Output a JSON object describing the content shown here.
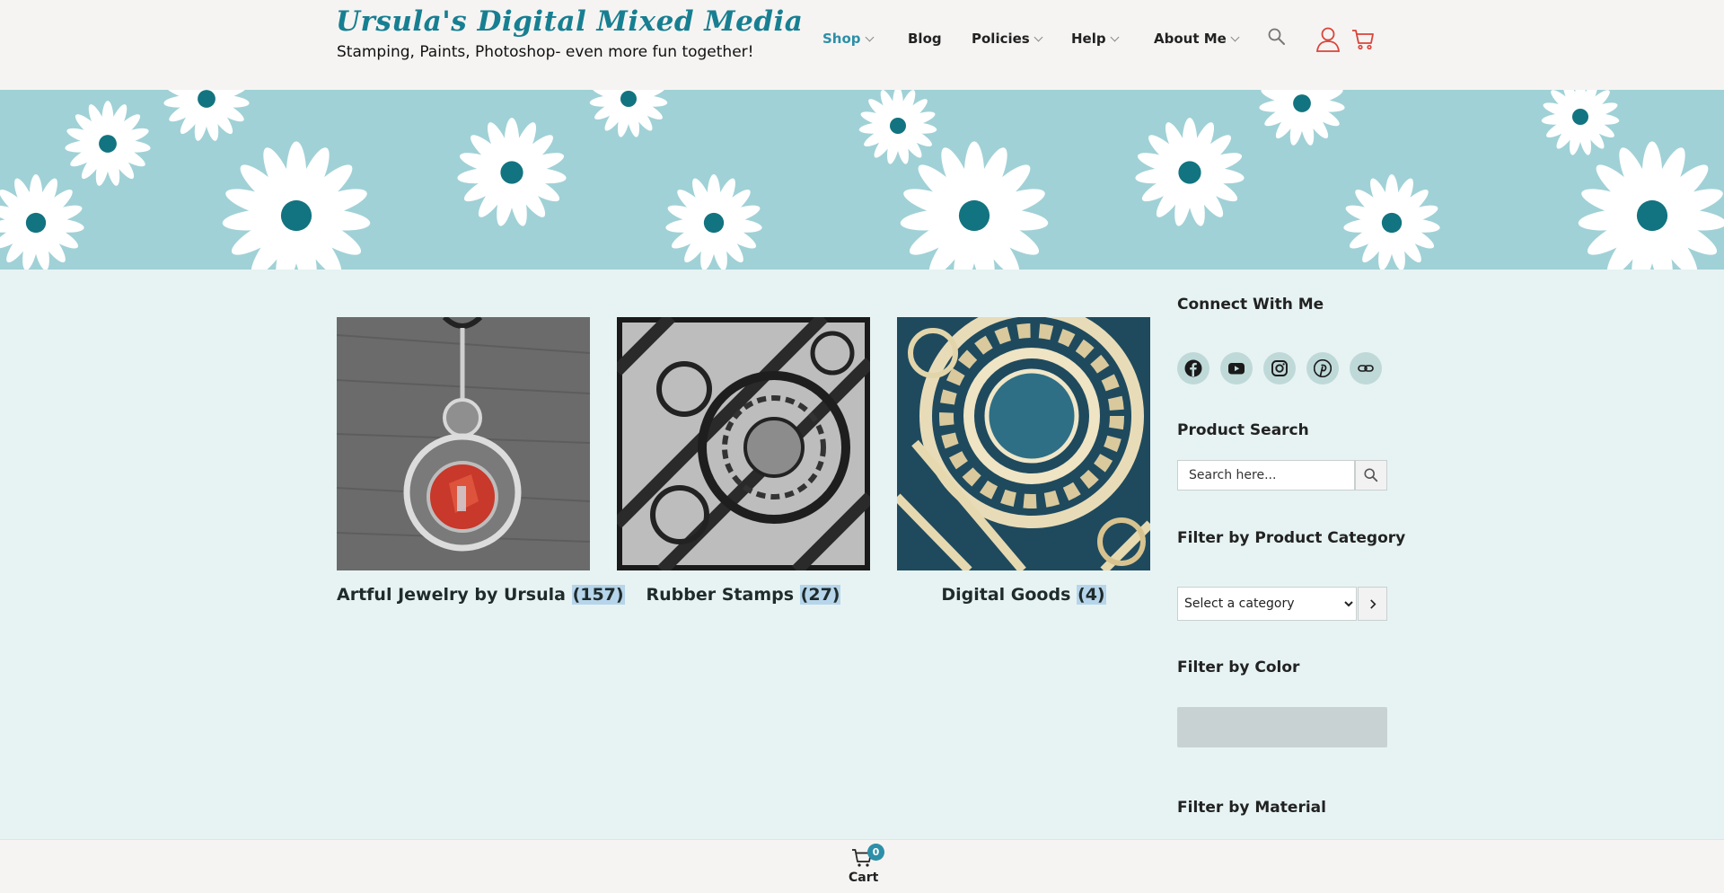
{
  "site": {
    "title": "Ursula's Digital Mixed Media",
    "tagline": "Stamping, Paints, Photoshop- even more fun together!"
  },
  "nav": {
    "items": [
      {
        "label": "Shop",
        "has_dropdown": true,
        "active": true
      },
      {
        "label": "Blog",
        "has_dropdown": false,
        "active": false
      },
      {
        "label": "Policies",
        "has_dropdown": true,
        "active": false
      },
      {
        "label": "Help",
        "has_dropdown": true,
        "active": false
      },
      {
        "label": "About Me",
        "has_dropdown": true,
        "active": false
      }
    ],
    "icons": [
      "search-icon",
      "user-icon",
      "cart-icon"
    ]
  },
  "products": [
    {
      "name": "Artful Jewelry by Ursula",
      "count": "(157)"
    },
    {
      "name": "Rubber Stamps",
      "count": "(27)"
    },
    {
      "name": "Digital Goods",
      "count": "(4)"
    }
  ],
  "sidebar": {
    "connect_title": "Connect With Me",
    "social": [
      "facebook-icon",
      "youtube-icon",
      "instagram-icon",
      "pinterest-icon",
      "link-icon"
    ],
    "product_search_title": "Product Search",
    "search_placeholder": "Search here...",
    "category_title": "Filter by Product Category",
    "category_selected": "Select a category",
    "color_title": "Filter by Color",
    "material_title": "Filter by Material"
  },
  "cart_bar": {
    "label": "Cart",
    "count": "0"
  },
  "colors": {
    "accent": "#2d8fa8",
    "title_teal": "#177f92",
    "page_bg": "#e7f3f3",
    "header_bg": "#f6f4f2",
    "cart_red": "#d9443a"
  }
}
